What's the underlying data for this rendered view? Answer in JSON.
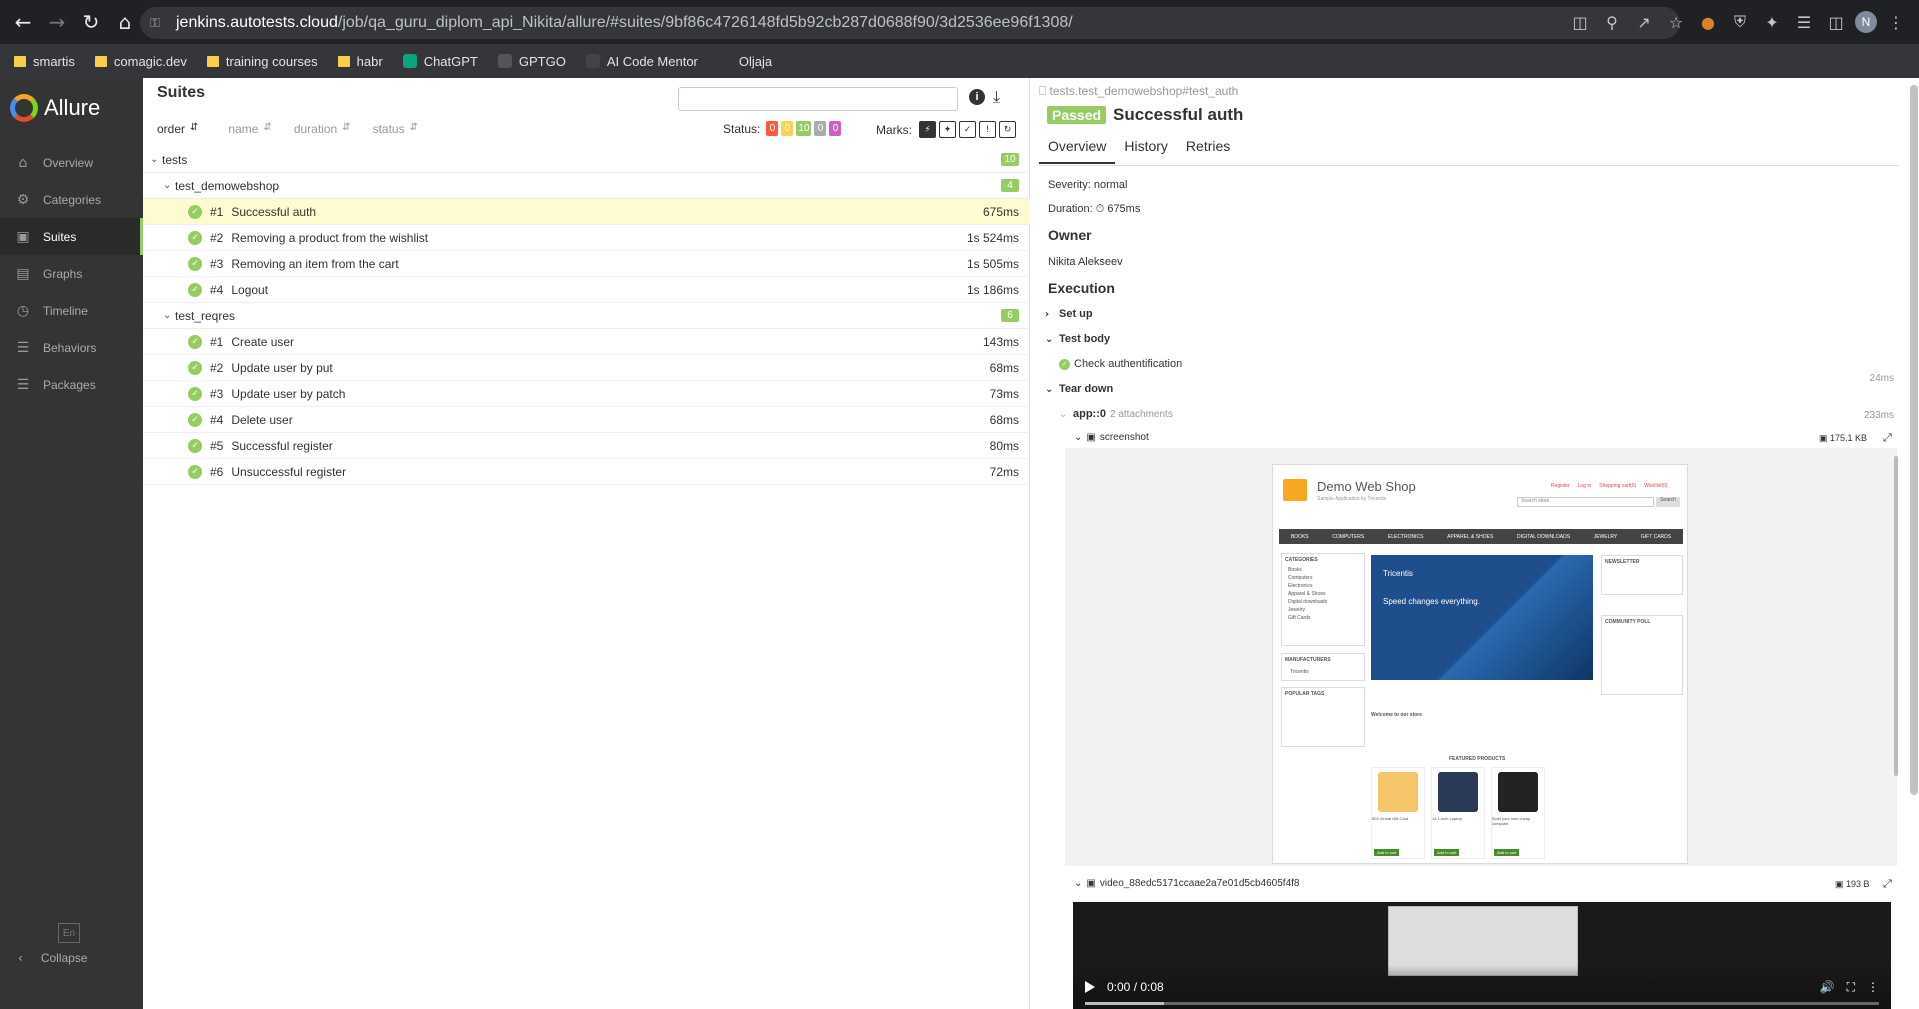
{
  "browser": {
    "url_host": "jenkins.autotests.cloud",
    "url_path": "/job/qa_guru_diplom_api_Nikita/allure/#suites/9bf86c4726148fd5b92cb287d0688f90/3d2536ee96f1308/",
    "profile_initial": "N",
    "bookmarks": [
      {
        "label": "smartis",
        "icon": "folder-icon"
      },
      {
        "label": "comagic.dev",
        "icon": "folder-icon"
      },
      {
        "label": "training courses",
        "icon": "folder-icon"
      },
      {
        "label": "habr",
        "icon": "folder-icon"
      },
      {
        "label": "ChatGPT",
        "icon": "chatgpt-icon"
      },
      {
        "label": "GPTGO",
        "icon": "gptgo-icon"
      },
      {
        "label": "AI Code Mentor",
        "icon": "ai-icon"
      },
      {
        "label": "Oljaja",
        "icon": "site-icon"
      }
    ]
  },
  "sidebar": {
    "brand": "Allure",
    "items": [
      {
        "label": "Overview",
        "icon": "home-icon",
        "active": false
      },
      {
        "label": "Categories",
        "icon": "bug-icon",
        "active": false
      },
      {
        "label": "Suites",
        "icon": "briefcase-icon",
        "active": true
      },
      {
        "label": "Graphs",
        "icon": "bar-chart-icon",
        "active": false
      },
      {
        "label": "Timeline",
        "icon": "clock-icon",
        "active": false
      },
      {
        "label": "Behaviors",
        "icon": "list-icon",
        "active": false
      },
      {
        "label": "Packages",
        "icon": "package-list-icon",
        "active": false
      }
    ],
    "language": "En",
    "collapse": "Collapse"
  },
  "suites": {
    "title": "Suites",
    "sort": [
      "order",
      "name",
      "duration",
      "status"
    ],
    "status_label": "Status:",
    "status_counts": [
      {
        "value": "0",
        "color": "#fd5a3e"
      },
      {
        "value": "0",
        "color": "#ffd050"
      },
      {
        "value": "10",
        "color": "#97cc64"
      },
      {
        "value": "0",
        "color": "#aaaaaa"
      },
      {
        "value": "0",
        "color": "#d35ebe"
      }
    ],
    "marks_label": "Marks:",
    "root": {
      "name": "tests",
      "count": "10"
    },
    "groups": [
      {
        "name": "test_demowebshop",
        "count": "4",
        "tests": [
          {
            "num": "#1",
            "name": "Successful auth",
            "duration": "675ms",
            "selected": true
          },
          {
            "num": "#2",
            "name": "Removing a product from the wishlist",
            "duration": "1s 524ms"
          },
          {
            "num": "#3",
            "name": "Removing an item from the cart",
            "duration": "1s 505ms"
          },
          {
            "num": "#4",
            "name": "Logout",
            "duration": "1s 186ms"
          }
        ]
      },
      {
        "name": "test_reqres",
        "count": "6",
        "tests": [
          {
            "num": "#1",
            "name": "Create user",
            "duration": "143ms"
          },
          {
            "num": "#2",
            "name": "Update user by put",
            "duration": "68ms"
          },
          {
            "num": "#3",
            "name": "Update user by patch",
            "duration": "73ms"
          },
          {
            "num": "#4",
            "name": "Delete user",
            "duration": "68ms"
          },
          {
            "num": "#5",
            "name": "Successful register",
            "duration": "80ms"
          },
          {
            "num": "#6",
            "name": "Unsuccessful register",
            "duration": "72ms"
          }
        ]
      }
    ]
  },
  "detail": {
    "breadcrumb": "tests.test_demowebshop#test_auth",
    "status": "Passed",
    "title": "Successful auth",
    "tabs": [
      "Overview",
      "History",
      "Retries"
    ],
    "severity": "Severity: normal",
    "duration": "Duration: ⏱ 675ms",
    "owner_heading": "Owner",
    "owner": "Nikita Alekseev",
    "execution_heading": "Execution",
    "setup": "Set up",
    "test_body": "Test body",
    "step": "Check authentification",
    "step_time": "24ms",
    "teardown": "Tear down",
    "app_label": "app::0",
    "app_attachments": "2 attachments",
    "app_time": "233ms",
    "screenshot_label": "screenshot",
    "screenshot_size": "175.1 KB",
    "video_label": "video_88edc5171ccaae2a7e01d5cb4605f4f8",
    "video_size": "193 B",
    "video_time": "0:00 / 0:08"
  },
  "webshop": {
    "title": "Demo Web Shop",
    "subtitle": "Sample Application by Tricentis",
    "search": "Search store",
    "search_btn": "Search",
    "top_links": [
      "Register",
      "Log in",
      "Shopping cart(0)",
      "Wishlist(0)"
    ],
    "menu": [
      "BOOKS",
      "COMPUTERS",
      "ELECTRONICS",
      "APPAREL & SHOES",
      "DIGITAL DOWNLOADS",
      "JEWELRY",
      "GIFT CARDS"
    ],
    "categories_h": "CATEGORIES",
    "categories": [
      "Books",
      "Computers",
      "Electronics",
      "Apparel & Shoes",
      "Digital downloads",
      "Jewelry",
      "Gift Cards"
    ],
    "manufacturers_h": "MANUFACTURERS",
    "manufacturer": "Tricentis",
    "tags_h": "POPULAR TAGS",
    "banner_brand": "Tricentis",
    "banner_text": "Speed changes everything.",
    "welcome": "Welcome to our store",
    "featured": "FEATURED PRODUCTS",
    "newsletter_h": "NEWSLETTER",
    "poll_h": "COMMUNITY POLL",
    "products": [
      "$25 Virtual Gift Card",
      "14.1-inch Laptop",
      "Build your own cheap computer"
    ],
    "add_btn": "Add to cart"
  }
}
